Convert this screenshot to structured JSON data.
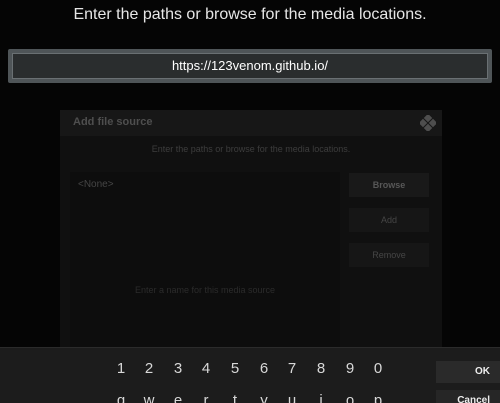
{
  "keyboard": {
    "heading": "Enter the paths or browse for the media locations.",
    "input_value": "https://123venom.github.io/",
    "number_keys": [
      "1",
      "2",
      "3",
      "4",
      "5",
      "6",
      "7",
      "8",
      "9",
      "0"
    ],
    "letter_keys": [
      "q",
      "w",
      "e",
      "r",
      "t",
      "y",
      "u",
      "i",
      "o",
      "p"
    ],
    "ok_label": "OK",
    "cancel_label": "Cancel"
  },
  "dialog": {
    "title": "Add file source",
    "subtitle": "Enter the paths or browse for the media locations.",
    "source_item": "<None>",
    "browse_label": "Browse",
    "add_label": "Add",
    "remove_label": "Remove",
    "hint": "Enter a name for this media source"
  },
  "colors": {
    "background": "#050505",
    "input_border": "#4f5558",
    "text": "#e6e6e6"
  }
}
